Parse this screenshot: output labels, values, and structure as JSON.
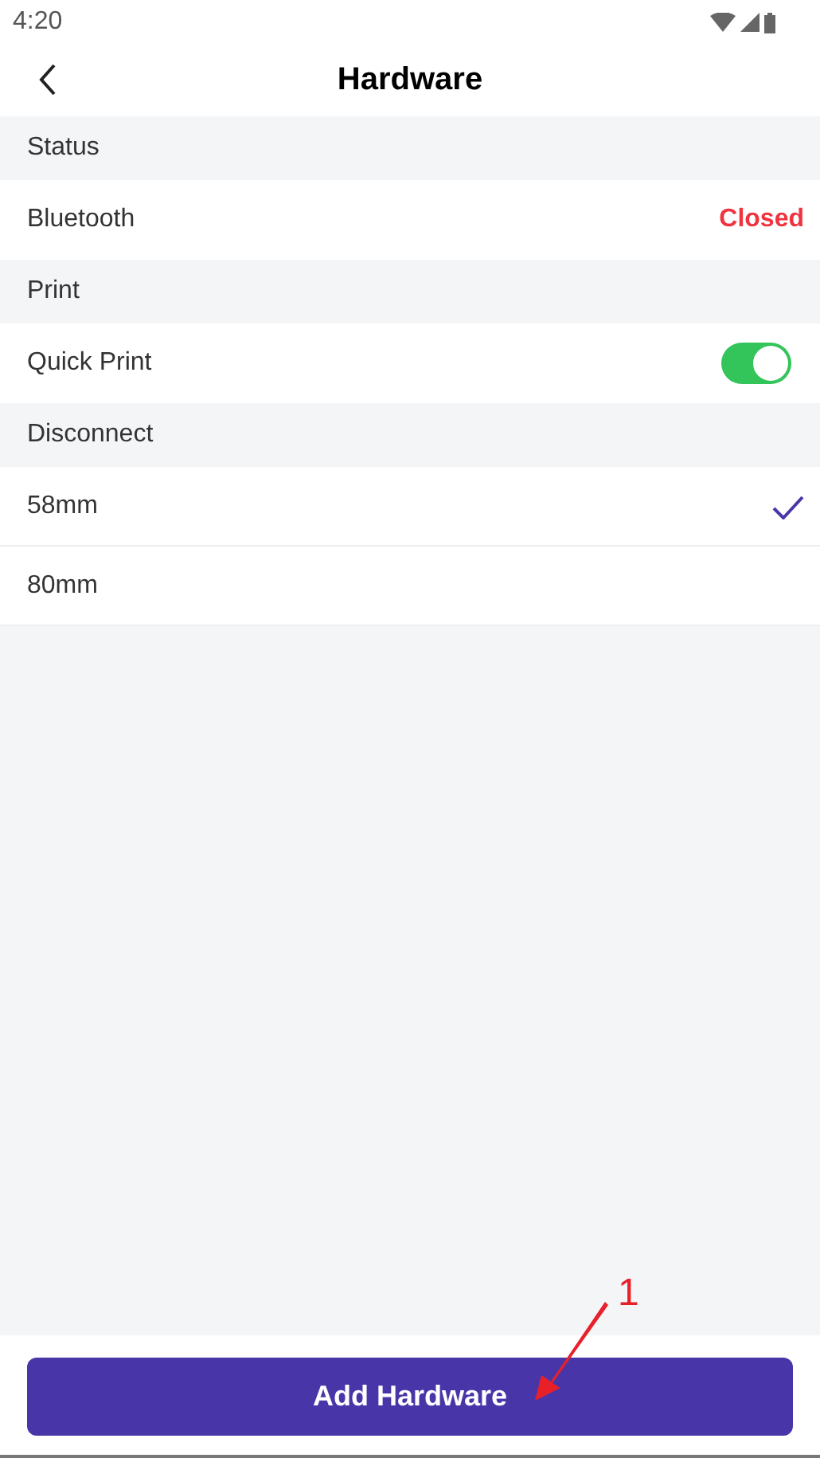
{
  "status_bar": {
    "time": "4:20"
  },
  "header": {
    "title": "Hardware"
  },
  "sections": [
    {
      "kind": "header",
      "label": "Status"
    },
    {
      "kind": "value",
      "label": "Bluetooth",
      "value": "Closed"
    },
    {
      "kind": "header",
      "label": "Print"
    },
    {
      "kind": "toggle",
      "label": "Quick Print",
      "on": true
    },
    {
      "kind": "header",
      "label": "Disconnect"
    },
    {
      "kind": "option",
      "label": "58mm",
      "selected": true
    },
    {
      "kind": "option",
      "label": "80mm",
      "selected": false
    }
  ],
  "footer": {
    "button": "Add Hardware"
  },
  "annotation": {
    "label": "1"
  }
}
